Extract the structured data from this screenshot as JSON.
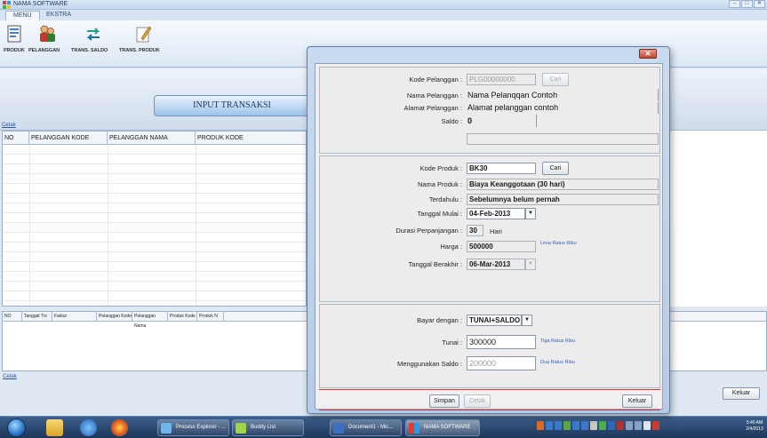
{
  "app": {
    "title": "NAMA SOFTWARE",
    "window_buttons": [
      "–",
      "□",
      "✕"
    ]
  },
  "tabs": [
    {
      "label": "MENU",
      "active": true
    },
    {
      "label": "EKSTRA",
      "active": false
    }
  ],
  "ribbon": {
    "buttons": [
      {
        "label": "PRODUK",
        "icon": "document-box-icon"
      },
      {
        "label": "PELANGGAN",
        "icon": "customer-people-icon"
      },
      {
        "label": "TRANS. SALDO",
        "icon": "arrows-transfer-icon"
      },
      {
        "label": "TRANS. PRODUK",
        "icon": "pen-paper-icon"
      }
    ]
  },
  "main": {
    "banner": "INPUT TRANSAKSI",
    "cetak_top": "Cetak",
    "grid1_columns": [
      "NO",
      "PELANGGAN KODE",
      "PELANGGAN NAMA",
      "PRODUK KODE"
    ],
    "grid2_columns": [
      "NO",
      "Tanggal Trx",
      "Faktur",
      "Pelanggan Kode",
      "Pelanggan Nama",
      "Produk Kode",
      "Produk N"
    ],
    "cetak_bottom": "Cetak",
    "keluar": "Keluar"
  },
  "dialog": {
    "close": "✕",
    "customer": {
      "kode_label": "Kode Pelanggan :",
      "kode_value": "PLG00000000",
      "cari_label": "Cari",
      "nama_label": "Nama Pelanggan :",
      "nama_value": "Nama Pelanqqan Contoh",
      "alamat_label": "Alamat Pelanggan :",
      "alamat_value": "Alamat pelanggan contoh",
      "saldo_label": "Saldo :",
      "saldo_value": "0"
    },
    "product": {
      "kode_label": "Kode Produk :",
      "kode_value": "BK30",
      "cari_label": "Cari",
      "nama_label": "Nama Produk :",
      "nama_value": "Biaya Keanggotaan (30 hari)",
      "terdahulu_label": "Terdahulu :",
      "terdahulu_value": "Sebelumnya belum pernah",
      "mulai_label": "Tanggal Mulai :",
      "mulai_value": "04-Feb-2013",
      "durasi_label": "Durasi Perpanjangan :",
      "durasi_value": "30",
      "durasi_unit": "Hari",
      "harga_label": "Harga :",
      "harga_value": "500000",
      "harga_words": "Lima Ratus  Ribu",
      "berakhir_label": "Tanggal Berakhir :",
      "berakhir_value": "06-Mar-2013"
    },
    "payment": {
      "bayar_label": "Bayar dengan :",
      "bayar_value": "TUNAI+SALDO",
      "tunai_label": "Tunai :",
      "tunai_value": "300000",
      "tunai_words": "Tiga Ratus  Ribu",
      "saldo_label": "Menggunakan Saldo :",
      "saldo_value": "200000",
      "saldo_words": "Dua Ratus  Ribu"
    },
    "buttons": {
      "simpan": "Simpan",
      "cetak": "Cetak",
      "keluar": "Keluar"
    }
  },
  "taskbar": {
    "tasks": [
      {
        "label": "Process Explorer - ...",
        "icon": "process-explorer-icon"
      },
      {
        "label": "Buddy List",
        "icon": "buddy-list-icon"
      },
      {
        "label": "Document1 - Mic...",
        "icon": "word-document-icon"
      },
      {
        "label": "NAMA SOFTWARE",
        "icon": "app-window-icon"
      }
    ],
    "clock_time": "5:40 AM",
    "clock_date": "2/4/2013"
  }
}
